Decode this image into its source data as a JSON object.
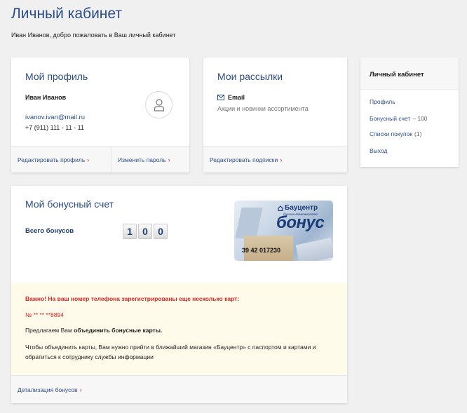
{
  "header": {
    "title": "Личный кабинет",
    "welcome": "Иван Иванов, добро пожаловать в Ваш личный кабинет"
  },
  "profile": {
    "title": "Мой профиль",
    "name": "Иван Иванов",
    "email": "ivanov.ivan@mail.ru",
    "phone": "+7 (911) 111 - 11 - 11",
    "edit_label": "Редактировать профиль",
    "password_label": "Изменить пароль"
  },
  "subscriptions": {
    "title": "Мои рассылки",
    "email_label": "Email",
    "email_desc": "Акции и новинки ассортимента",
    "edit_label": "Редактировать подписки"
  },
  "sidenav": {
    "title": "Личный кабинет",
    "items": [
      {
        "label": "Профиль",
        "count": ""
      },
      {
        "label": "Бонусный счет",
        "count": "– 100"
      },
      {
        "label": "Списки покупок",
        "count": "(1)"
      },
      {
        "label": "Выход",
        "count": ""
      }
    ]
  },
  "bonus": {
    "title": "Мой бонусный счет",
    "total_label": "Всего бонусов",
    "digits": [
      "1",
      "0",
      "0"
    ],
    "card": {
      "brand": "Бауцентр",
      "brand_sub": "больше возможностей",
      "brand_big": "бонус",
      "number": "39 42 017230"
    },
    "notice": {
      "warning": "Важно! На ваш номер телефона зарегистрированы еще несколько карт:",
      "card_number": "№ ** ** **8894",
      "offer_prefix": "Предлагаем Вам ",
      "offer_bold": "объединить бонусные карты.",
      "info": "Чтобы объединить карты, Вам нужно прийти в ближайший магазин «Бауцентр» с паспортом и картами и обратиться к сотруднику службы информации"
    },
    "detail_label": "Детализация бонусов"
  },
  "colors": {
    "accent": "#2b4d86",
    "warning": "#d42424",
    "chevron": "#e02b2b"
  }
}
